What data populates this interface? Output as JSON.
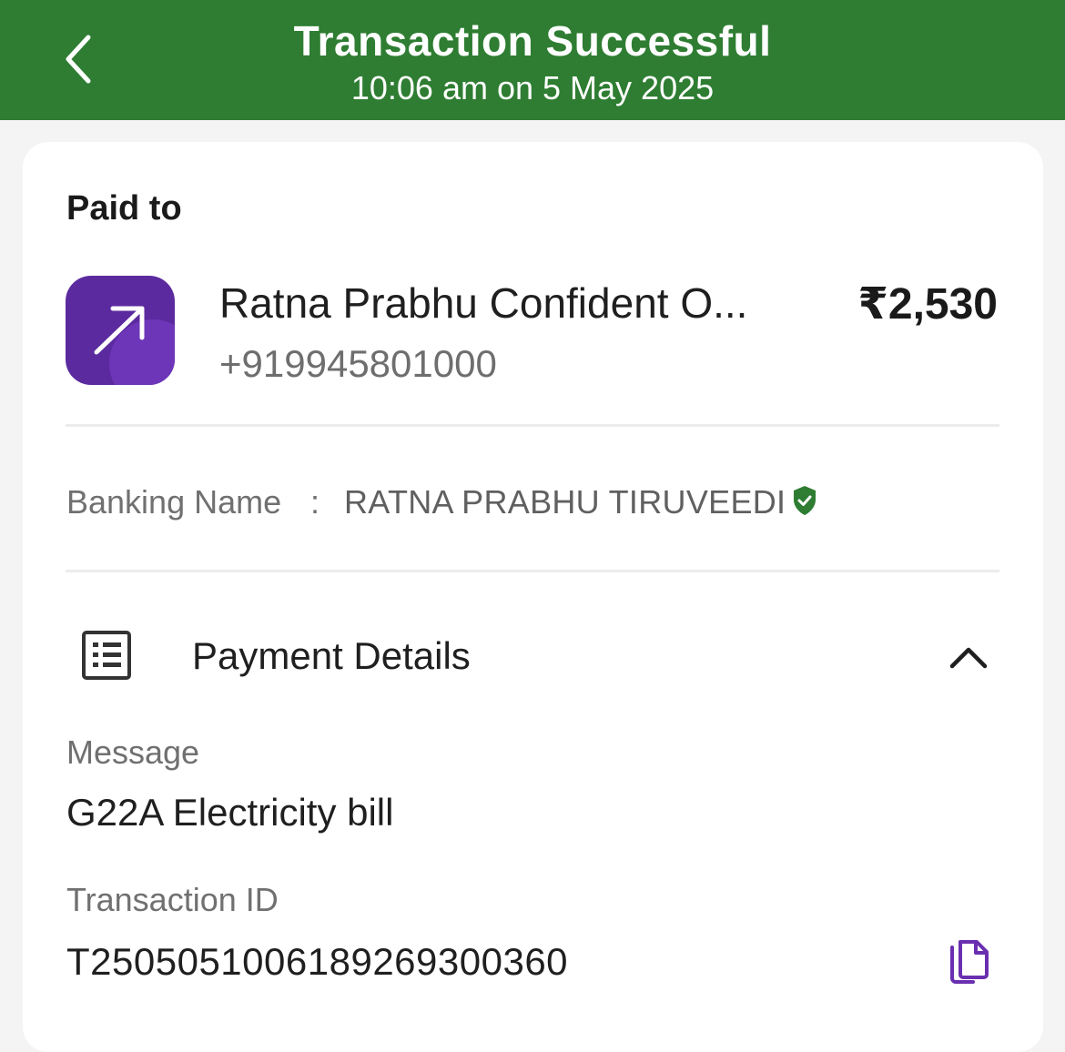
{
  "header": {
    "title": "Transaction Successful",
    "subtitle": "10:06 am on 5 May 2025",
    "background_color": "#2e7d32",
    "back_icon": "chevron-left-icon"
  },
  "paid_to": {
    "heading": "Paid to",
    "merchant_name": "Ratna Prabhu Confident O...",
    "phone": "+919945801000",
    "amount": "₹2,530",
    "logo_icon": "arrow-up-right-icon",
    "logo_color": "#5b2a9f"
  },
  "banking": {
    "label": "Banking Name",
    "separator": ":",
    "value": "RATNA PRABHU TIRUVEEDI",
    "verified_icon": "verified-shield-icon",
    "verified_color": "#2e7d32"
  },
  "payment_details": {
    "title": "Payment Details",
    "icon": "receipt-list-icon",
    "toggle_icon": "chevron-up-icon",
    "message_label": "Message",
    "message_value": "G22A Electricity bill",
    "transaction_id_label": "Transaction ID",
    "transaction_id_value": "T2505051006189269300360",
    "copy_icon": "copy-icon",
    "copy_icon_color": "#6a2fb0"
  }
}
